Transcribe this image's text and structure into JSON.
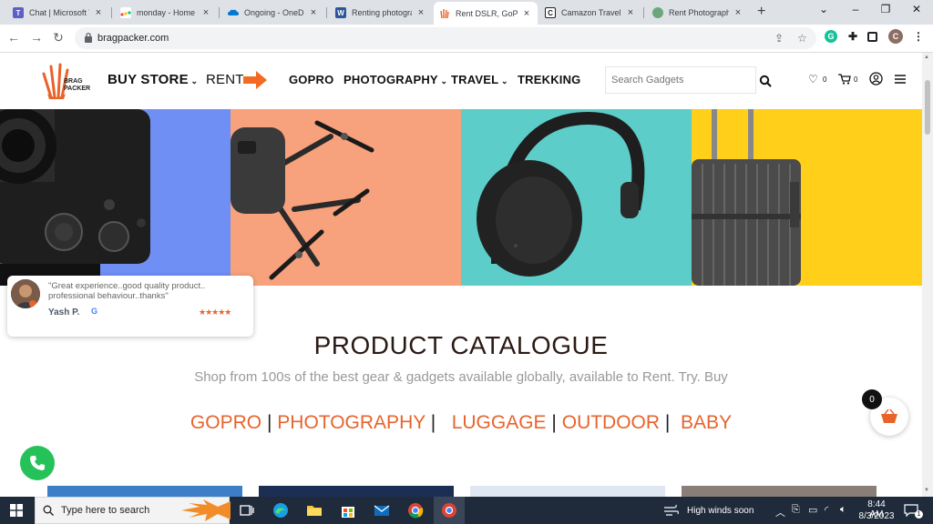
{
  "browser": {
    "tabs": [
      {
        "title": "Chat | Microsoft Teams",
        "icon": "teams-icon",
        "color": "#5b5fc7",
        "active": false
      },
      {
        "title": "monday - Home",
        "icon": "monday-icon",
        "color": "#ff3d57",
        "active": false
      },
      {
        "title": "Ongoing - OneDrive",
        "icon": "onedrive-icon",
        "color": "#0078d4",
        "active": false
      },
      {
        "title": "Renting photography",
        "icon": "word-icon",
        "color": "#2b579a",
        "active": false
      },
      {
        "title": "Rent DSLR, GoPro",
        "icon": "bragpacker-icon",
        "color": "#e8632b",
        "active": true
      },
      {
        "title": "Camazon Travel &",
        "icon": "camazon-icon",
        "color": "#222222",
        "active": false
      },
      {
        "title": "Rent Photography",
        "icon": "globe-icon",
        "color": "#6aa87b",
        "active": false
      }
    ],
    "url": "bragpacker.com",
    "profile_initial": "C"
  },
  "header": {
    "logo_text_line1": "BRAG",
    "logo_text_line2": "PACKER",
    "buy_store": "BUY STORE",
    "rent": "RENT",
    "nav": [
      "GOPRO",
      "PHOTOGRAPHY",
      "TRAVEL",
      "TREKKING"
    ],
    "search_placeholder": "Search Gadgets",
    "wishlist_count": "0",
    "cart_count": "0"
  },
  "review": {
    "quote": "\"Great experience..good quality product.. professional behaviour..thanks\"",
    "reviewer": "Yash P.",
    "source_mark": "G",
    "stars": "★★★★★"
  },
  "catalogue": {
    "title": "PRODUCT CATALOGUE",
    "subtitle": "Shop from 100s of the best gear & gadgets available globally, available to Rent. Try. Buy",
    "links": [
      "GOPRO",
      "PHOTOGRAPHY",
      "LUGGAGE",
      "OUTDOOR",
      "BABY"
    ],
    "separator": "|"
  },
  "floating_cart": {
    "count": "0"
  },
  "taskbar": {
    "search_placeholder": "Type here to search",
    "weather": "High winds soon",
    "time": "8:44 AM",
    "date": "8/3/2023",
    "notification_count": "1"
  },
  "colors": {
    "accent": "#e8632b",
    "hero_blue": "#6f8ff5",
    "hero_peach": "#f7a27c",
    "hero_teal": "#5ccdc9",
    "hero_yellow": "#ffcf1a"
  }
}
